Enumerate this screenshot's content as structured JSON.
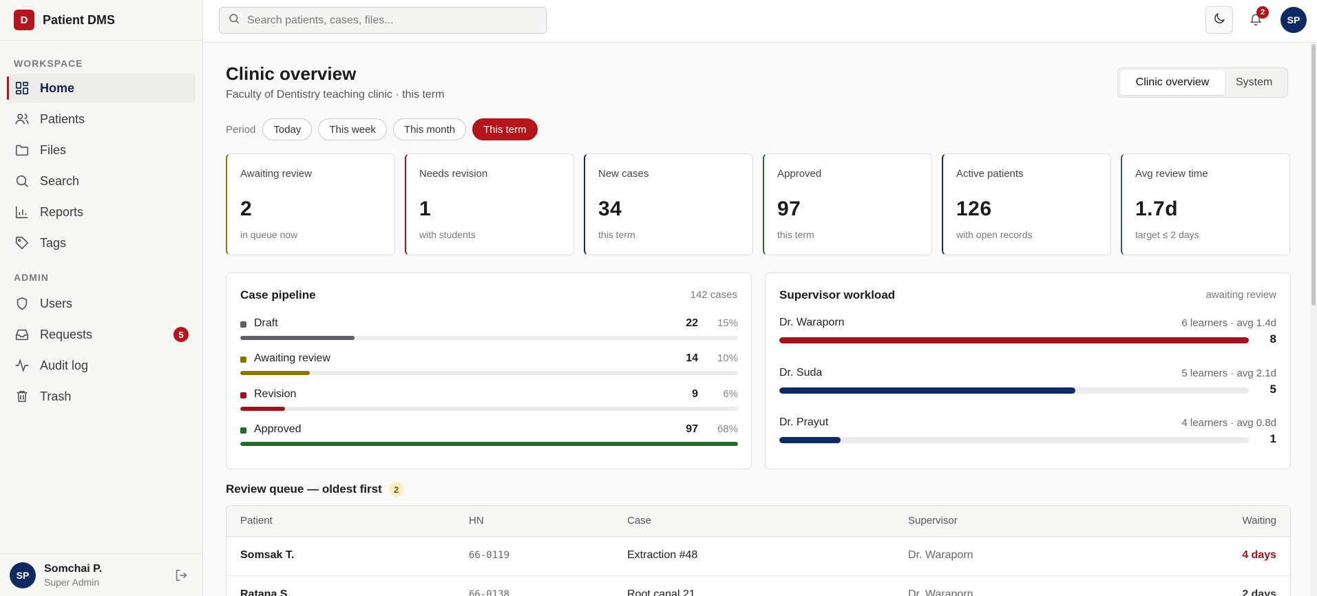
{
  "app": {
    "logo_letter": "D",
    "name": "Patient DMS"
  },
  "sidebar": {
    "workspace_label": "WORKSPACE",
    "admin_label": "ADMIN",
    "items": [
      {
        "label": "Home",
        "icon": "grid-icon",
        "active": true
      },
      {
        "label": "Patients",
        "icon": "users-icon"
      },
      {
        "label": "Files",
        "icon": "folder-icon"
      },
      {
        "label": "Search",
        "icon": "search-icon"
      },
      {
        "label": "Reports",
        "icon": "bar-chart-icon"
      },
      {
        "label": "Tags",
        "icon": "tag-icon"
      }
    ],
    "admin_items": [
      {
        "label": "Users",
        "icon": "shield-icon"
      },
      {
        "label": "Requests",
        "icon": "inbox-icon",
        "badge": "5"
      },
      {
        "label": "Audit log",
        "icon": "activity-icon"
      },
      {
        "label": "Trash",
        "icon": "trash-icon"
      }
    ],
    "user": {
      "initials": "SP",
      "name": "Somchai P.",
      "role": "Super Admin"
    }
  },
  "topbar": {
    "search_placeholder": "Search patients, cases, files...",
    "notifications_count": "2",
    "avatar_initials": "SP"
  },
  "page": {
    "title": "Clinic overview",
    "subtitle": "Faculty of Dentistry teaching clinic · this term",
    "view_options": [
      "Clinic overview",
      "System"
    ],
    "period_label": "Period",
    "periods": [
      "Today",
      "This week",
      "This month",
      "This term"
    ],
    "active_period": "This term"
  },
  "kpis": [
    {
      "label": "Awaiting review",
      "value": "2",
      "sub": "in queue now",
      "accent": "#8a7400"
    },
    {
      "label": "Needs revision",
      "value": "1",
      "sub": "with students",
      "accent": "#a31218"
    },
    {
      "label": "New cases",
      "value": "34",
      "sub": "this term",
      "accent": "#0f2a63"
    },
    {
      "label": "Approved",
      "value": "97",
      "sub": "this term",
      "accent": "#236b2e"
    },
    {
      "label": "Active patients",
      "value": "126",
      "sub": "with open records",
      "accent": "#0f2a63"
    },
    {
      "label": "Avg review time",
      "value": "1.7d",
      "sub": "target ≤ 2 days",
      "accent": "#3a5560"
    }
  ],
  "pipeline": {
    "title": "Case pipeline",
    "meta": "142 cases",
    "rows": [
      {
        "name": "Draft",
        "count": "22",
        "pct": "15%",
        "fraction": 0.23,
        "color": "#5f5f63"
      },
      {
        "name": "Awaiting review",
        "count": "14",
        "pct": "10%",
        "fraction": 0.14,
        "color": "#8a7400"
      },
      {
        "name": "Revision",
        "count": "9",
        "pct": "6%",
        "fraction": 0.09,
        "color": "#a31218"
      },
      {
        "name": "Approved",
        "count": "97",
        "pct": "68%",
        "fraction": 1.0,
        "color": "#236b2e"
      }
    ]
  },
  "workload": {
    "title": "Supervisor workload",
    "meta": "awaiting review",
    "rows": [
      {
        "name": "Dr. Waraporn",
        "meta": "6 learners · avg 1.4d",
        "count": "8",
        "fraction": 1.0,
        "color": "#a31218"
      },
      {
        "name": "Dr. Suda",
        "meta": "5 learners · avg 2.1d",
        "count": "5",
        "fraction": 0.63,
        "color": "#0f2a63"
      },
      {
        "name": "Dr. Prayut",
        "meta": "4 learners · avg 0.8d",
        "count": "1",
        "fraction": 0.13,
        "color": "#0f2a63"
      }
    ]
  },
  "queue": {
    "title": "Review queue — oldest first",
    "count": "2",
    "columns": [
      "Patient",
      "HN",
      "Case",
      "Supervisor",
      "Waiting"
    ],
    "rows": [
      {
        "patient": "Somsak T.",
        "hn": "66-0119",
        "case": "Extraction #48",
        "supervisor": "Dr. Waraporn",
        "waiting": "4 days",
        "waiting_color": "#a31218"
      },
      {
        "patient": "Ratana S.",
        "hn": "66-0138",
        "case": "Root canal 21",
        "supervisor": "Dr. Waraporn",
        "waiting": "2 days",
        "waiting_color": "#333333"
      }
    ]
  }
}
